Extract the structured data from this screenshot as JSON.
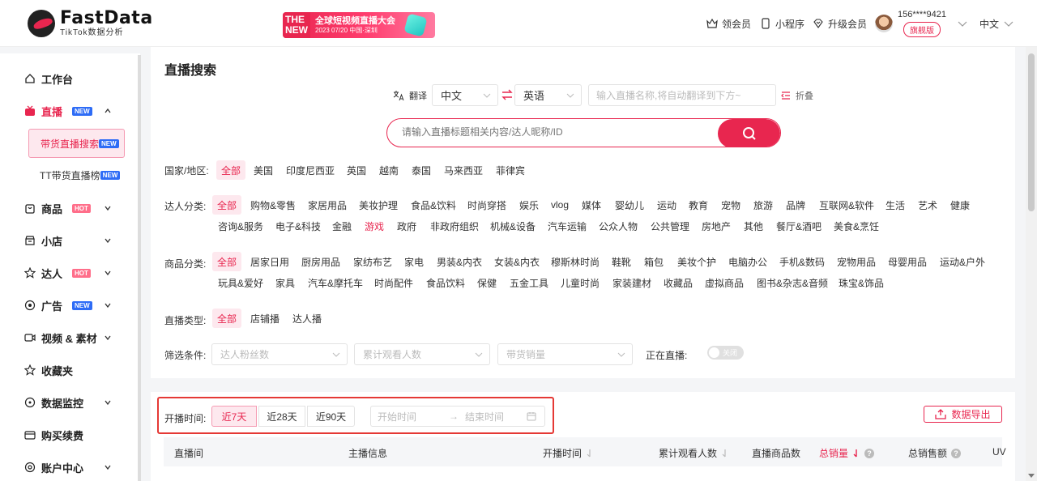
{
  "header": {
    "logo_name": "FastData",
    "logo_sub": "TikTok数据分析",
    "banner": {
      "badge_line1": "THE",
      "badge_line2": "NEW",
      "title": "全球短视频直播大会",
      "subtitle": "2023  07/20 中国·深圳"
    },
    "coupon": "领会员",
    "miniapp": "小程序",
    "upgrade": "升级会员",
    "phone": "156****9421",
    "vip": "旗舰版",
    "language": "中文"
  },
  "sidebar": {
    "workbench": "工作台",
    "live": "直播",
    "live_tag": "NEW",
    "live_sub1": "带货直播搜索",
    "live_sub1_tag": "NEW",
    "live_sub2": "TT带货直播榜",
    "live_sub2_tag": "NEW",
    "goods": "商品",
    "goods_tag": "HOT",
    "shop": "小店",
    "influencer": "达人",
    "influencer_tag": "HOT",
    "ads": "广告",
    "ads_tag": "NEW",
    "video": "视频 & 素材",
    "favorites": "收藏夹",
    "monitor": "数据监控",
    "renew": "购买续费",
    "account": "账户中心"
  },
  "main": {
    "title": "直播搜索",
    "translate_label": "翻译",
    "lang_from": "中文",
    "lang_to": "英语",
    "translate_placeholder": "输入直播名称,将自动翻译到下方~",
    "fold": "折叠",
    "search_placeholder": "请输入直播标题相关内容/达人昵称/ID",
    "region_label": "国家/地区:",
    "regions": [
      "全部",
      "美国",
      "印度尼西亚",
      "英国",
      "越南",
      "泰国",
      "马来西亚",
      "菲律宾"
    ],
    "talent_label": "达人分类:",
    "talent_row1": [
      "全部",
      "购物&零售",
      "家居用品",
      "美妆护理",
      "食品&饮料",
      "时尚穿搭",
      "娱乐",
      "vlog",
      "媒体",
      "婴幼儿",
      "运动",
      "教育",
      "宠物",
      "旅游",
      "品牌",
      "互联网&软件",
      "生活",
      "艺术",
      "健康"
    ],
    "talent_row2": [
      "咨询&服务",
      "电子&科技",
      "金融",
      "游戏",
      "政府",
      "非政府组织",
      "机械&设备",
      "汽车运输",
      "公众人物",
      "公共管理",
      "房地产",
      "其他",
      "餐厅&酒吧",
      "美食&烹饪"
    ],
    "product_label": "商品分类:",
    "product_row1": [
      "全部",
      "居家日用",
      "厨房用品",
      "家纺布艺",
      "家电",
      "男装&内衣",
      "女装&内衣",
      "穆斯林时尚",
      "鞋靴",
      "箱包",
      "美妆个护",
      "电脑办公",
      "手机&数码",
      "宠物用品",
      "母婴用品",
      "运动&户外"
    ],
    "product_row2": [
      "玩具&爱好",
      "家具",
      "汽车&摩托车",
      "时尚配件",
      "食品饮料",
      "保健",
      "五金工具",
      "儿童时尚",
      "家装建材",
      "收藏品",
      "虚拟商品",
      "图书&杂志&音频",
      "珠宝&饰品"
    ],
    "live_type_label": "直播类型:",
    "live_types": [
      "全部",
      "店铺播",
      "达人播"
    ],
    "filter_label": "筛选条件:",
    "filter_fans": "达人粉丝数",
    "filter_viewers": "累计观看人数",
    "filter_sales": "带货销量",
    "on_air_label": "正在直播:",
    "toggle_text": "关闭"
  },
  "table": {
    "time_label": "开播时间:",
    "ranges": [
      "近7天",
      "近28天",
      "近90天"
    ],
    "start_placeholder": "开始时间",
    "end_placeholder": "结束时间",
    "arrow": "→",
    "export": "数据导出",
    "columns": [
      "直播间",
      "主播信息",
      "开播时间",
      "累计观看人数",
      "直播商品数",
      "总销量",
      "总销售额",
      "UV"
    ]
  }
}
